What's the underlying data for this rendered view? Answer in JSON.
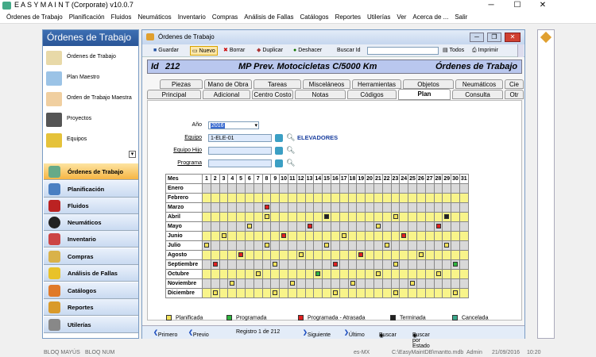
{
  "app": {
    "title": "E A S Y   M A I N T   (Corporate)  v10.0.7"
  },
  "menu": [
    "Órdenes de Trabajo",
    "Planificación",
    "Fluidos",
    "Neumáticos",
    "Inventario",
    "Compras",
    "Análisis de Fallas",
    "Catálogos",
    "Reportes",
    "Utilerías",
    "Ver",
    "Acerca de ...",
    "Salir"
  ],
  "sidebar": {
    "title": "Órdenes de Trabajo",
    "items": [
      "Órdenes de Trabajo",
      "Plan Maestro",
      "Orden de Trabajo Maestra",
      "Proyectos",
      "Equipos"
    ],
    "nav": [
      "Órdenes de Trabajo",
      "Planificación",
      "Fluidos",
      "Neumáticos",
      "Inventario",
      "Compras",
      "Análisis de Fallas",
      "Catálogos",
      "Reportes",
      "Utilerías"
    ]
  },
  "window": {
    "title": "Órdenes de Trabajo"
  },
  "toolbar": {
    "guardar": "Guardar",
    "nuevo": "Nuevo",
    "borrar": "Borrar",
    "duplicar": "Duplicar",
    "deshacer": "Deshacer",
    "buscar": "Buscar Id",
    "todos": "Todos",
    "imprimir": "Imprimir"
  },
  "header": {
    "id_label": "Id",
    "id": "212",
    "desc": "MP Prev. Motocicletas C/5000 Km",
    "type": "Órdenes de Trabajo"
  },
  "tabs_row1": [
    "Piezas",
    "Mano de Obra",
    "Tareas",
    "Misceláneos",
    "Herramientas",
    "Objetos",
    "Neumáticos",
    "Cie"
  ],
  "tabs_row2": [
    "Principal",
    "Adicional",
    "Centro Costo",
    "Notas",
    "Códigos",
    "Plan",
    "Consulta",
    "Otr"
  ],
  "form": {
    "anio_label": "Año",
    "anio": "2016",
    "equipo_label": "Equipo",
    "equipo": "1-ELE-01",
    "equipo_desc": "ELEVADORES",
    "hijo_label": "Equipo Hijo",
    "programa_label": "Programa"
  },
  "grid": {
    "month_header": "Mes",
    "months": [
      "Enero",
      "Febrero",
      "Marzo",
      "Abril",
      "Mayo",
      "Junio",
      "Julio",
      "Agosto",
      "Septiembre",
      "Octubre",
      "Noviembre",
      "Diciembre"
    ],
    "days": [
      1,
      2,
      3,
      4,
      5,
      6,
      7,
      8,
      9,
      10,
      11,
      12,
      13,
      14,
      15,
      16,
      17,
      18,
      19,
      20,
      21,
      22,
      23,
      24,
      25,
      26,
      27,
      28,
      29,
      30,
      31
    ],
    "marks": [
      {
        "m": 2,
        "d": 8,
        "s": "red"
      },
      {
        "m": 3,
        "d": 8,
        "s": "yellow"
      },
      {
        "m": 3,
        "d": 15,
        "s": "black"
      },
      {
        "m": 3,
        "d": 23,
        "s": "yellow"
      },
      {
        "m": 3,
        "d": 29,
        "s": "black"
      },
      {
        "m": 4,
        "d": 6,
        "s": "yellow"
      },
      {
        "m": 4,
        "d": 13,
        "s": "red"
      },
      {
        "m": 4,
        "d": 21,
        "s": "yellow"
      },
      {
        "m": 4,
        "d": 28,
        "s": "red"
      },
      {
        "m": 5,
        "d": 3,
        "s": "yellow"
      },
      {
        "m": 5,
        "d": 10,
        "s": "red"
      },
      {
        "m": 5,
        "d": 17,
        "s": "yellow"
      },
      {
        "m": 5,
        "d": 24,
        "s": "red"
      },
      {
        "m": 6,
        "d": 1,
        "s": "yellow"
      },
      {
        "m": 6,
        "d": 8,
        "s": "yellow"
      },
      {
        "m": 6,
        "d": 15,
        "s": "yellow"
      },
      {
        "m": 6,
        "d": 22,
        "s": "yellow"
      },
      {
        "m": 6,
        "d": 29,
        "s": "yellow"
      },
      {
        "m": 7,
        "d": 5,
        "s": "red"
      },
      {
        "m": 7,
        "d": 12,
        "s": "yellow"
      },
      {
        "m": 7,
        "d": 19,
        "s": "red"
      },
      {
        "m": 7,
        "d": 26,
        "s": "yellow"
      },
      {
        "m": 8,
        "d": 2,
        "s": "red"
      },
      {
        "m": 8,
        "d": 9,
        "s": "yellow"
      },
      {
        "m": 8,
        "d": 16,
        "s": "red"
      },
      {
        "m": 8,
        "d": 23,
        "s": "yellow"
      },
      {
        "m": 8,
        "d": 30,
        "s": "green"
      },
      {
        "m": 9,
        "d": 7,
        "s": "yellow"
      },
      {
        "m": 9,
        "d": 14,
        "s": "green"
      },
      {
        "m": 9,
        "d": 21,
        "s": "yellow"
      },
      {
        "m": 9,
        "d": 28,
        "s": "yellow"
      },
      {
        "m": 10,
        "d": 4,
        "s": "yellow"
      },
      {
        "m": 10,
        "d": 11,
        "s": "yellow"
      },
      {
        "m": 10,
        "d": 18,
        "s": "yellow"
      },
      {
        "m": 10,
        "d": 25,
        "s": "yellow"
      },
      {
        "m": 11,
        "d": 2,
        "s": "yellow"
      },
      {
        "m": 11,
        "d": 9,
        "s": "yellow"
      },
      {
        "m": 11,
        "d": 16,
        "s": "yellow"
      },
      {
        "m": 11,
        "d": 23,
        "s": "yellow"
      },
      {
        "m": 11,
        "d": 30,
        "s": "yellow"
      }
    ]
  },
  "legend": [
    "Planificada",
    "Programada",
    "Programada - Atrasada",
    "Terminada",
    "Cancelada"
  ],
  "colors": {
    "yellow": "#f3e35a",
    "green": "#2fb53f",
    "red": "#e02020",
    "black": "#222222",
    "cancel": "#3aa88a",
    "planned_row": "#f8f48a",
    "grey_row": "#d9d9d9"
  },
  "navbar": {
    "primero": "Primero",
    "previo": "Previo",
    "registro": "Registro 1 de 212",
    "siguiente": "Siguiente",
    "ultimo": "Último",
    "buscar": "Buscar",
    "buscar_estado": "Buscar por Estado"
  },
  "status": [
    "BLOQ MAYÚS",
    "BLOQ NUM",
    "es-MX",
    "C:\\EasyMaintDB\\mantto.mdb",
    "Admin",
    "21/09/2016",
    "10:20"
  ]
}
